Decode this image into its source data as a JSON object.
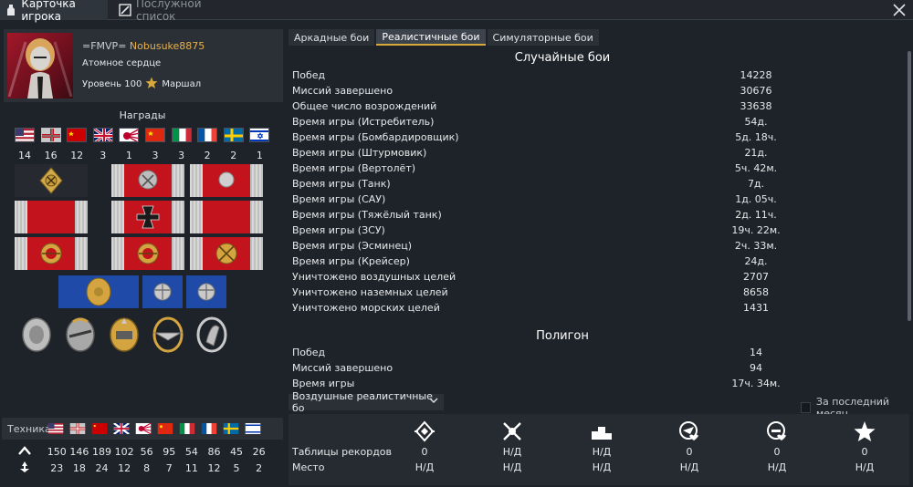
{
  "top_tabs": [
    {
      "label": "Карточка игрока",
      "icon": "player-card-icon"
    },
    {
      "label": "Послужной список",
      "icon": "service-record-icon"
    }
  ],
  "player": {
    "tag": "=FMVP=",
    "nickname": "Nobusuke8875",
    "title": "Атомное сердце",
    "level": "Уровень 100",
    "rank": "Маршал"
  },
  "awards": {
    "title": "Награды",
    "nations": [
      "usa",
      "germany",
      "ussr",
      "britain",
      "japan",
      "china",
      "italy",
      "france",
      "sweden",
      "israel"
    ],
    "counts": [
      "14",
      "16",
      "12",
      "3",
      "1",
      "3",
      "3",
      "2",
      "2",
      "1"
    ],
    "selected": "germany"
  },
  "tech": {
    "label": "Техника",
    "nations": [
      "usa",
      "germany",
      "ussr",
      "britain",
      "japan",
      "china",
      "italy",
      "france",
      "sweden",
      "israel"
    ],
    "owned": [
      "150",
      "146",
      "189",
      "102",
      "56",
      "95",
      "54",
      "86",
      "45",
      "26"
    ],
    "elite": [
      "23",
      "18",
      "24",
      "12",
      "8",
      "7",
      "11",
      "12",
      "5",
      "2"
    ]
  },
  "mode_tabs": [
    {
      "label": "Аркадные бои",
      "active": false
    },
    {
      "label": "Реалистичные бои",
      "active": true
    },
    {
      "label": "Симуляторные бои",
      "active": false
    }
  ],
  "random_battles": {
    "title": "Случайные бои",
    "rows": [
      {
        "label": "Побед",
        "value": "14228"
      },
      {
        "label": "Миссий завершено",
        "value": "30676"
      },
      {
        "label": "Общее число возрождений",
        "value": "33638"
      },
      {
        "label": "Время игры (Истребитель)",
        "value": "54д."
      },
      {
        "label": "Время игры (Бомбардировщик)",
        "value": "5д. 18ч."
      },
      {
        "label": "Время игры (Штурмовик)",
        "value": "21д."
      },
      {
        "label": "Время игры (Вертолёт)",
        "value": "5ч. 42м."
      },
      {
        "label": "Время игры (Танк)",
        "value": "7д."
      },
      {
        "label": "Время игры (САУ)",
        "value": "1д. 05ч."
      },
      {
        "label": "Время игры (Тяжёлый танк)",
        "value": "2д. 11ч."
      },
      {
        "label": "Время игры (ЗСУ)",
        "value": "19ч. 22м."
      },
      {
        "label": "Время игры (Эсминец)",
        "value": "2ч. 33м."
      },
      {
        "label": "Время игры (Крейсер)",
        "value": "24д."
      },
      {
        "label": "Уничтожено воздушных целей",
        "value": "2707"
      },
      {
        "label": "Уничтожено наземных целей",
        "value": "8658"
      },
      {
        "label": "Уничтожено морских целей",
        "value": "1431"
      }
    ]
  },
  "polygon": {
    "title": "Полигон",
    "rows": [
      {
        "label": "Побед",
        "value": "14"
      },
      {
        "label": "Миссий завершено",
        "value": "94"
      },
      {
        "label": "Время игры",
        "value": "17ч. 34м."
      }
    ]
  },
  "leaderboard": {
    "dropdown": "Воздушные реалистичные бо",
    "last_month_label": "За последний месяц",
    "icons": [
      "wins-icon",
      "kills-icon",
      "rank-icon",
      "air-kills-icon",
      "ground-kills-icon",
      "star-icon"
    ],
    "rows": [
      {
        "label": "Таблицы рекордов",
        "values": [
          "0",
          "Н/Д",
          "Н/Д",
          "0",
          "0",
          "0"
        ]
      },
      {
        "label": "Место",
        "values": [
          "Н/Д",
          "Н/Д",
          "Н/Д",
          "Н/Д",
          "Н/Д",
          "Н/Д"
        ]
      }
    ]
  },
  "colors": {
    "accent": "#d6a93a",
    "nickname": "#e8b14a",
    "background": "#1e2329",
    "panel": "#2b3037"
  }
}
